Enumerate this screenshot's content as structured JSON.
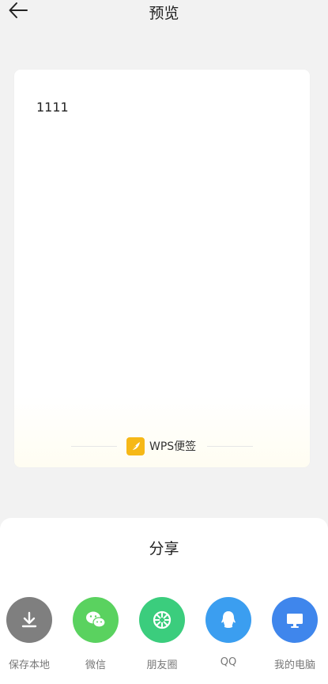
{
  "header": {
    "title": "预览",
    "back_icon": "arrow-left-icon"
  },
  "note": {
    "content": "1111",
    "brand_label": "WPS便签",
    "brand_color": "#f6b817"
  },
  "share": {
    "title": "分享",
    "items": [
      {
        "label": "保存本地",
        "icon": "download-icon",
        "color": "#7f7f7f"
      },
      {
        "label": "微信",
        "icon": "wechat-icon",
        "color": "#5ad25f"
      },
      {
        "label": "朋友圈",
        "icon": "moments-icon",
        "color": "#3bcd7d"
      },
      {
        "label": "QQ",
        "icon": "qq-icon",
        "color": "#3b9ef0"
      },
      {
        "label": "我的电脑",
        "icon": "computer-icon",
        "color": "#3f86ec"
      }
    ]
  }
}
